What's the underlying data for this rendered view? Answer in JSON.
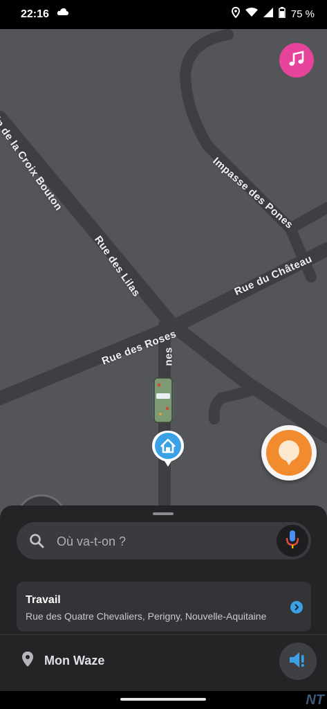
{
  "status_bar": {
    "time": "22:16",
    "battery": "75 %",
    "icons": [
      "cloud-icon",
      "location-icon",
      "wifi-icon",
      "signal-icon",
      "battery-icon"
    ]
  },
  "map": {
    "streets": [
      "in de la Croix Bouton",
      "Rue des Lilas",
      "Impasse des Pones",
      "Rue du Château",
      "Rue des Roses",
      "nes"
    ],
    "colors": {
      "background": "#545559",
      "road": "#3e3f43",
      "road_border": "#4a4b4f"
    }
  },
  "buttons": {
    "music_icon": "music-note-icon",
    "report_icon": "report-pin-icon"
  },
  "sheet": {
    "search_placeholder": "Où va-t-on ?",
    "favorite": {
      "title": "Travail",
      "address": "Rue des Quatre Chevaliers, Perigny, Nouvelle-Aquitaine"
    },
    "my_waze": "Mon Waze"
  },
  "watermark": "NT",
  "accent_colors": {
    "music": "#e6439a",
    "report": "#f28a2e",
    "link": "#3aa1e6"
  }
}
